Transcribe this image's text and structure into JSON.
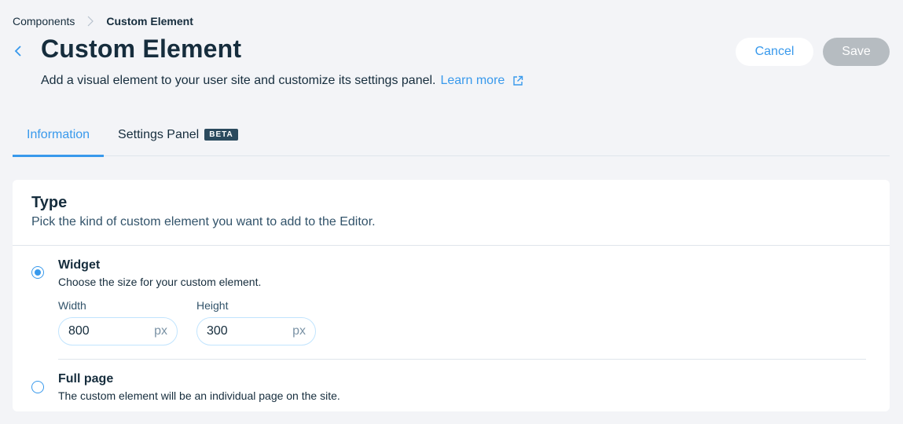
{
  "breadcrumb": {
    "parent": "Components",
    "current": "Custom Element"
  },
  "header": {
    "title": "Custom Element",
    "subtitle": "Add a visual element to your user site and customize its settings panel.",
    "learn_more": "Learn more",
    "cancel_label": "Cancel",
    "save_label": "Save"
  },
  "tabs": [
    {
      "label": "Information",
      "active": true
    },
    {
      "label": "Settings Panel",
      "badge": "BETA",
      "active": false
    }
  ],
  "type_section": {
    "title": "Type",
    "description": "Pick the kind of custom element you want to add to the Editor.",
    "options": [
      {
        "label": "Widget",
        "description": "Choose the size for your custom element.",
        "selected": true,
        "fields": [
          {
            "label": "Width",
            "value": "800",
            "unit": "px"
          },
          {
            "label": "Height",
            "value": "300",
            "unit": "px"
          }
        ]
      },
      {
        "label": "Full page",
        "description": "The custom element will be an individual page on the site.",
        "selected": false
      }
    ]
  },
  "colors": {
    "accent": "#3899ec",
    "text": "#162d3d",
    "background": "#f3f4f7",
    "save_disabled": "#b6bcc1"
  }
}
